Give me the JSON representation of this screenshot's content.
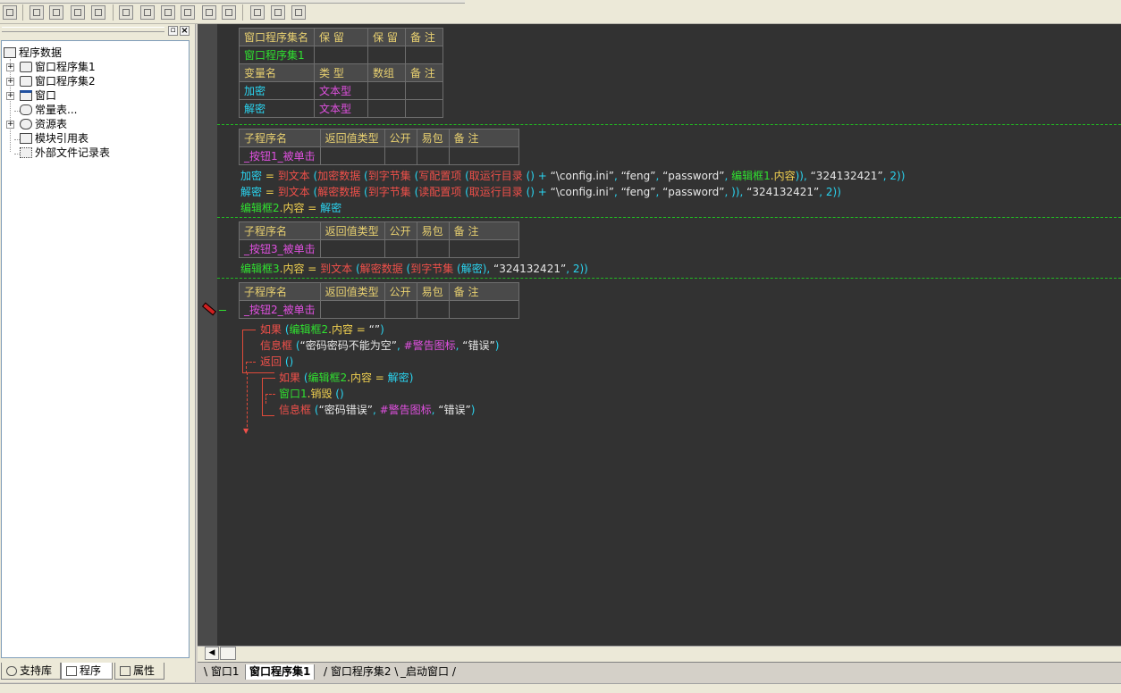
{
  "tree": {
    "root": "程序数据",
    "items": [
      "窗口程序集1",
      "窗口程序集2",
      "窗口",
      "常量表...",
      "资源表",
      "模块引用表",
      "外部文件记录表"
    ]
  },
  "left_tabs": [
    "支持库",
    "程序",
    "属性"
  ],
  "assembly_table": {
    "headers": [
      "窗口程序集名",
      "保 留",
      "保 留",
      "备 注"
    ],
    "name": "窗口程序集1",
    "var_headers": [
      "变量名",
      "类 型",
      "数组",
      "备 注"
    ],
    "vars": [
      {
        "name": "加密",
        "type": "文本型"
      },
      {
        "name": "解密",
        "type": "文本型"
      }
    ]
  },
  "sub_headers": [
    "子程序名",
    "返回值类型",
    "公开",
    "易包",
    "备 注"
  ],
  "subs": [
    {
      "name": "_按钮1_被单击"
    },
    {
      "name": "_按钮3_被单击"
    },
    {
      "name": "_按钮2_被单击"
    }
  ],
  "code": {
    "l1": {
      "a": "加密",
      "eq": " = ",
      "f1": "到文本",
      "f2": " (",
      "f3": "加密数据",
      "f4": " (",
      "f5": "到字节集",
      "f6": " (",
      "f7": "写配置项",
      "f8": " (",
      "f9": "取运行目录",
      "f10": " () + ",
      "s1": "“\\config.ini”",
      "c1": ", ",
      "s2": "“feng”",
      "c2": ", ",
      "s3": "“password”",
      "c3": ", ",
      "f11": "编辑框1",
      "f12": ".内容",
      "t": ")), ",
      "s4": "“324132421”",
      "c4": ", 2))"
    },
    "l2": {
      "a": "解密",
      "eq": " = ",
      "f1": "到文本",
      "f2": " (",
      "f3": "解密数据",
      "f4": " (",
      "f5": "到字节集",
      "f6": " (",
      "f7": "读配置项",
      "f8": " (",
      "f9": "取运行目录",
      "f10": " () + ",
      "s1": "“\\config.ini”",
      "c1": ", ",
      "s2": "“feng”",
      "c2": ", ",
      "s3": "“password”",
      "c3": ", )), ",
      "s4": "“324132421”",
      "c4": ", 2))"
    },
    "l3": {
      "a": "编辑框2",
      "b": ".内容",
      "eq": " = ",
      "c": "解密"
    },
    "l4": {
      "a": "编辑框3",
      "b": ".内容",
      "eq": " = ",
      "f1": "到文本",
      "f2": " (",
      "f3": "解密数据",
      "f4": " (",
      "f5": "到字节集",
      "f6": " (",
      "f7": "解密",
      "t": "), ",
      "s4": "“324132421”",
      "c4": ", 2))"
    },
    "l5": {
      "kw": "如果",
      "p": " (",
      "a": "编辑框2",
      "b": ".内容",
      "eq": " = ",
      "s": "“”",
      "e": ")"
    },
    "l6": {
      "f": "信息框",
      "p": " (",
      "s1": "“密码密码不能为空”",
      "c": ", ",
      "k": "#警告图标",
      "c2": ", ",
      "s2": "“错误”",
      "e": ")"
    },
    "l7": {
      "kw": "返回",
      "p": " ()"
    },
    "l8": {
      "kw": "如果",
      "p": " (",
      "a": "编辑框2",
      "b": ".内容",
      "eq": " = ",
      "c": "解密",
      "e": ")"
    },
    "l9": {
      "a": "窗口1",
      "b": ".销毁",
      "p": " ()"
    },
    "l10": {
      "f": "信息框",
      "p": " (",
      "s1": "“密码错误”",
      "c": ", ",
      "k": "#警告图标",
      "c2": ", ",
      "s2": "“错误”",
      "e": ")"
    }
  },
  "code_tabs": [
    "窗口1",
    "窗口程序集1",
    "窗口程序集2",
    "_启动窗口"
  ]
}
